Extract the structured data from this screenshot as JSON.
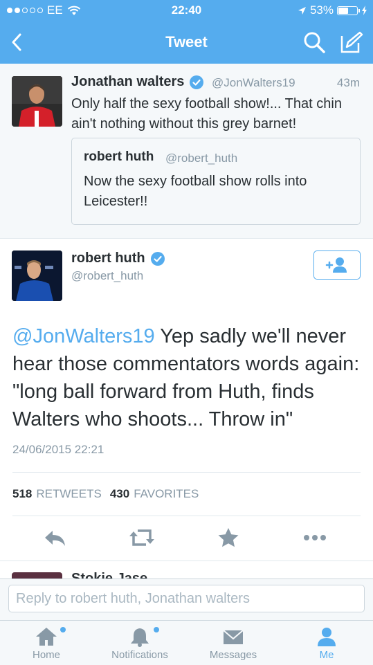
{
  "status_bar": {
    "carrier": "EE",
    "time": "22:40",
    "battery_percent": "53%",
    "signal_bars_filled": 2,
    "signal_bars_total": 5
  },
  "nav": {
    "title": "Tweet"
  },
  "parent_tweet": {
    "author_name": "Jonathan walters",
    "handle": "@JonWalters19",
    "time_ago": "43m",
    "text": "Only half the sexy football show!... That chin ain't nothing without this grey barnet!",
    "quoted": {
      "author_name": "robert huth",
      "handle": "@robert_huth",
      "text": "Now the sexy football show rolls into Leicester!!"
    }
  },
  "main_tweet": {
    "author_name": "robert huth",
    "handle": "@robert_huth",
    "mention": "@JonWalters19",
    "text": " Yep sadly we'll never hear those commentators words again: \"long ball forward from Huth, finds Walters who shoots... Throw in\"",
    "date": "24/06/2015 22:21",
    "retweets_count": "518",
    "retweets_label": "RETWEETS",
    "favorites_count": "430",
    "favorites_label": "FAVORITES"
  },
  "next_tweet_peek": {
    "author_name": "Stokie Jase"
  },
  "reply": {
    "placeholder": "Reply to robert huth, Jonathan walters"
  },
  "tabs": [
    {
      "label": "Home",
      "icon": "home-icon",
      "has_dot": true
    },
    {
      "label": "Notifications",
      "icon": "bell-icon",
      "has_dot": true
    },
    {
      "label": "Messages",
      "icon": "envelope-icon",
      "has_dot": false
    },
    {
      "label": "Me",
      "icon": "person-icon",
      "active": true
    }
  ],
  "colors": {
    "brand_blue": "#55acee",
    "text": "#292f33",
    "muted": "#8899a6",
    "verified": "#55acee"
  }
}
